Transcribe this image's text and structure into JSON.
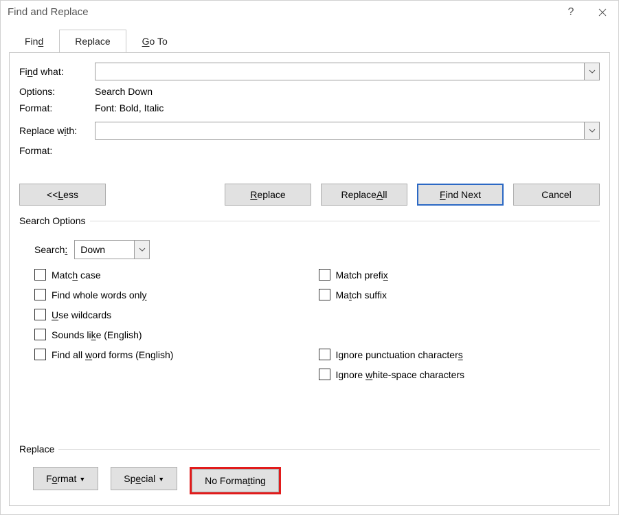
{
  "title": "Find and Replace",
  "tabs": {
    "find": "d",
    "find_pref": "Fin",
    "replace": "Replace",
    "goto_pref": "",
    "goto": "G",
    "goto_suf": "o To"
  },
  "labels": {
    "find_what_pref": "Fi",
    "find_what_u": "n",
    "find_what_suf": "d what:",
    "options": "Options:",
    "format": "Format:",
    "replace_with_pref": "Replace w",
    "replace_with_u": "i",
    "replace_with_suf": "th:",
    "format2": "Format:"
  },
  "values": {
    "options": "Search Down",
    "format": "Font: Bold, Italic"
  },
  "buttons": {
    "less": "ess",
    "less_pref": "<< ",
    "less_u": "L",
    "replace_u": "R",
    "replace_suf": "eplace",
    "replace_all_pref": "Replace ",
    "replace_all_u": "A",
    "replace_all_suf": "ll",
    "find_next_u": "F",
    "find_next_suf": "ind Next",
    "cancel": "Cancel"
  },
  "search_options": {
    "legend": "Search Options",
    "search_label": "Search",
    "search_u": ":",
    "direction": "Down"
  },
  "checks": {
    "match_case_pref": "Matc",
    "match_case_u": "h",
    "match_case_suf": " case",
    "whole_words_pref": "Find whole words onl",
    "whole_words_u": "y",
    "wildcards_u": "U",
    "wildcards_suf": "se wildcards",
    "sounds_like": "Sounds li",
    "sounds_like_u": "k",
    "sounds_like_suf": "e (English)",
    "word_forms_pref": "Find all ",
    "word_forms_u": "w",
    "word_forms_suf": "ord forms (English)",
    "match_prefix": "Match prefi",
    "match_prefix_u": "x",
    "match_suffix_pref": "Ma",
    "match_suffix_u": "t",
    "match_suffix_suf": "ch suffix",
    "ignore_punct_pref": "Ignore punctuation character",
    "ignore_punct_u": "s",
    "ignore_ws_pref": "Ignore ",
    "ignore_ws_u": "w",
    "ignore_ws_suf": "hite-space characters"
  },
  "bottom": {
    "legend": "Replace",
    "format_pref": "F",
    "format_u": "o",
    "format_suf": "rmat",
    "special_pref": "Sp",
    "special_u": "e",
    "special_suf": "cial",
    "noformat_pref": "No Forma",
    "noformat_u": "t",
    "noformat_suf": "ting"
  }
}
